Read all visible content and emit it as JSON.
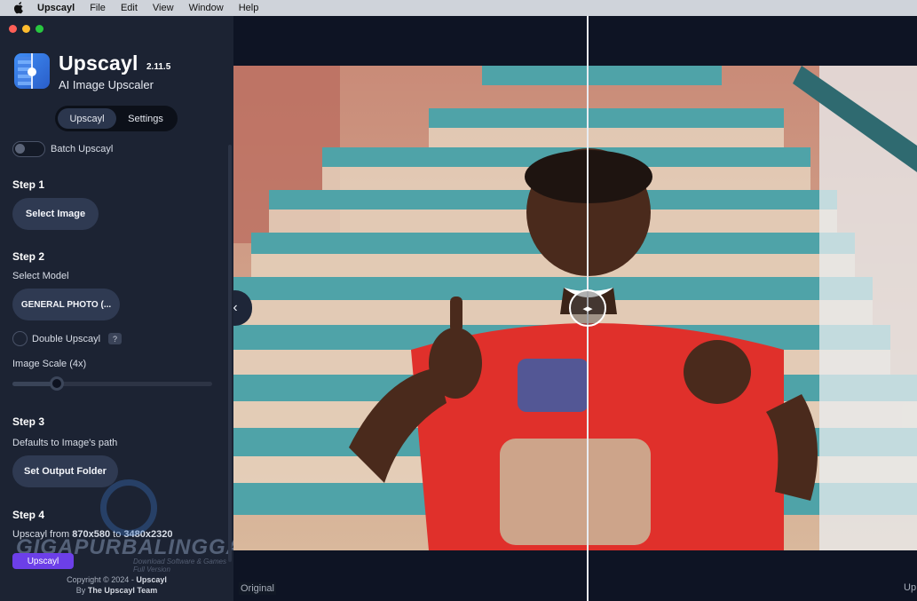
{
  "menubar": {
    "app": "Upscayl",
    "items": [
      "File",
      "Edit",
      "View",
      "Window",
      "Help"
    ]
  },
  "app": {
    "name": "Upscayl",
    "version": "2.11.5",
    "subtitle": "AI Image Upscaler"
  },
  "tabs": [
    {
      "label": "Upscayl",
      "active": true
    },
    {
      "label": "Settings",
      "active": false
    }
  ],
  "batch": {
    "label": "Batch Upscayl",
    "enabled": false
  },
  "step1": {
    "title": "Step 1",
    "button": "Select Image"
  },
  "step2": {
    "title": "Step 2",
    "model_label": "Select Model",
    "model_value": "GENERAL PHOTO (...",
    "double_label": "Double Upscayl",
    "double_help": "?",
    "scale_label": "Image Scale (4x)",
    "scale_fraction": 0.22
  },
  "step3": {
    "title": "Step 3",
    "path_label": "Defaults to Image's path",
    "button": "Set Output Folder"
  },
  "step4": {
    "title": "Step 4",
    "from_prefix": "Upscayl from",
    "from_size": "870x580",
    "to_word": "to",
    "to_size": "3480x2320",
    "button": "Upscayl"
  },
  "footer": {
    "line1_prefix": "Copyright © 2024 -",
    "line1_brand": "Upscayl",
    "line2_prefix": "By",
    "line2_team": "The Upscayl Team"
  },
  "watermark": {
    "text": "GIGAPURBALINGGA",
    "sub": "Download Software & Games Full Version"
  },
  "viewer": {
    "left_label": "Original",
    "right_label": "Up",
    "collapse_icon": "‹",
    "handle_icon": "◂▸"
  },
  "colors": {
    "accent": "#6c3fe8",
    "sidebar": "#1c2333",
    "button": "#2f3a52"
  }
}
